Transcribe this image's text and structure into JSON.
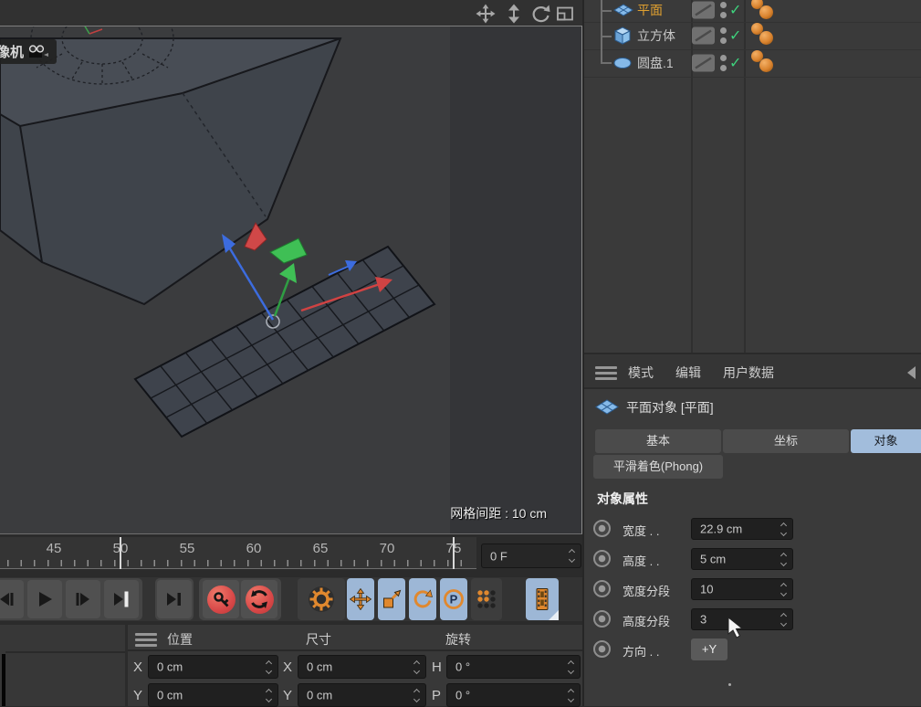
{
  "viewport": {
    "camera_label": "摄像机",
    "grid_spacing_label": "网格间距 : 10 cm",
    "nav_icons": [
      "pan-view-icon",
      "zoom-view-icon",
      "rotate-view-icon",
      "toggle-view-icon"
    ]
  },
  "timeline": {
    "numbers": [
      "45",
      "50",
      "55",
      "60",
      "65",
      "70",
      "75"
    ],
    "frame_field": "0 F"
  },
  "transport": {
    "buttons": [
      "previous-frame",
      "play-forward",
      "next-frame",
      "goto-end",
      "goto-next-key",
      "record-keyframe",
      "autokeying",
      "keyframe-selection-options",
      "record-position",
      "record-scale",
      "record-rotation",
      "record-parameter",
      "record-point-level-animation",
      "open-timeline"
    ],
    "record_param_glyph": "P"
  },
  "coordinates": {
    "columns": [
      "位置",
      "尺寸",
      "旋转"
    ],
    "fields": [
      {
        "axis": "X",
        "value": "0 cm"
      },
      {
        "axis": "X",
        "value": "0 cm"
      },
      {
        "axis": "H",
        "value": "0 °"
      },
      {
        "axis": "Y",
        "value": "0 cm"
      },
      {
        "axis": "Y",
        "value": "0 cm"
      },
      {
        "axis": "P",
        "value": "0 °"
      }
    ]
  },
  "object_manager": {
    "check_glyph": "✓",
    "objects": [
      {
        "name": "平面",
        "icon": "plane-icon",
        "selected": true
      },
      {
        "name": "立方体",
        "icon": "cube-icon",
        "selected": false
      },
      {
        "name": "圆盘.1",
        "icon": "disc-icon",
        "selected": false
      }
    ]
  },
  "attributes": {
    "menu": [
      "模式",
      "编辑",
      "用户数据"
    ],
    "object_title": "平面对象 [平面]",
    "tabs": [
      "基本",
      "坐标",
      "对象"
    ],
    "active_tab": "对象",
    "phong_tab": "平滑着色(Phong)",
    "section_title": "对象属性",
    "properties": [
      {
        "label": "宽度 . .",
        "value": "22.9 cm"
      },
      {
        "label": "高度 . .",
        "value": "5 cm"
      },
      {
        "label": "宽度分段",
        "value": "10"
      },
      {
        "label": "高度分段",
        "value": "3"
      },
      {
        "label": "方向 . .",
        "value": "+Y"
      }
    ]
  },
  "colors": {
    "selected_object_text": "#e0a030",
    "accent_orange": "#e0882e",
    "record_red": "#d84848",
    "check_green": "#3ed27d",
    "active_tab_blue": "#a2bddc",
    "object_icon_blue": "#85b9e8"
  }
}
